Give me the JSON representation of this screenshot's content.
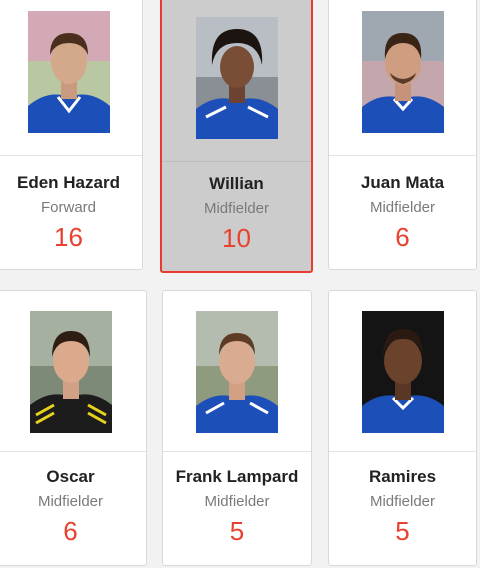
{
  "players": [
    {
      "name": "Eden Hazard",
      "position": "Forward",
      "number": "16",
      "selected": false
    },
    {
      "name": "Willian",
      "position": "Midfielder",
      "number": "10",
      "selected": true
    },
    {
      "name": "Juan Mata",
      "position": "Midfielder",
      "number": "6",
      "selected": false
    },
    {
      "name": "Oscar",
      "position": "Midfielder",
      "number": "6",
      "selected": false
    },
    {
      "name": "Frank Lampard",
      "position": "Midfielder",
      "number": "5",
      "selected": false
    },
    {
      "name": "Ramires",
      "position": "Midfielder",
      "number": "5",
      "selected": false
    }
  ],
  "colors": {
    "accent": "#e8412f",
    "selected_border": "#e83a2e",
    "selected_bg": "#cccccc",
    "kit_blue": "#1d4fb8"
  }
}
